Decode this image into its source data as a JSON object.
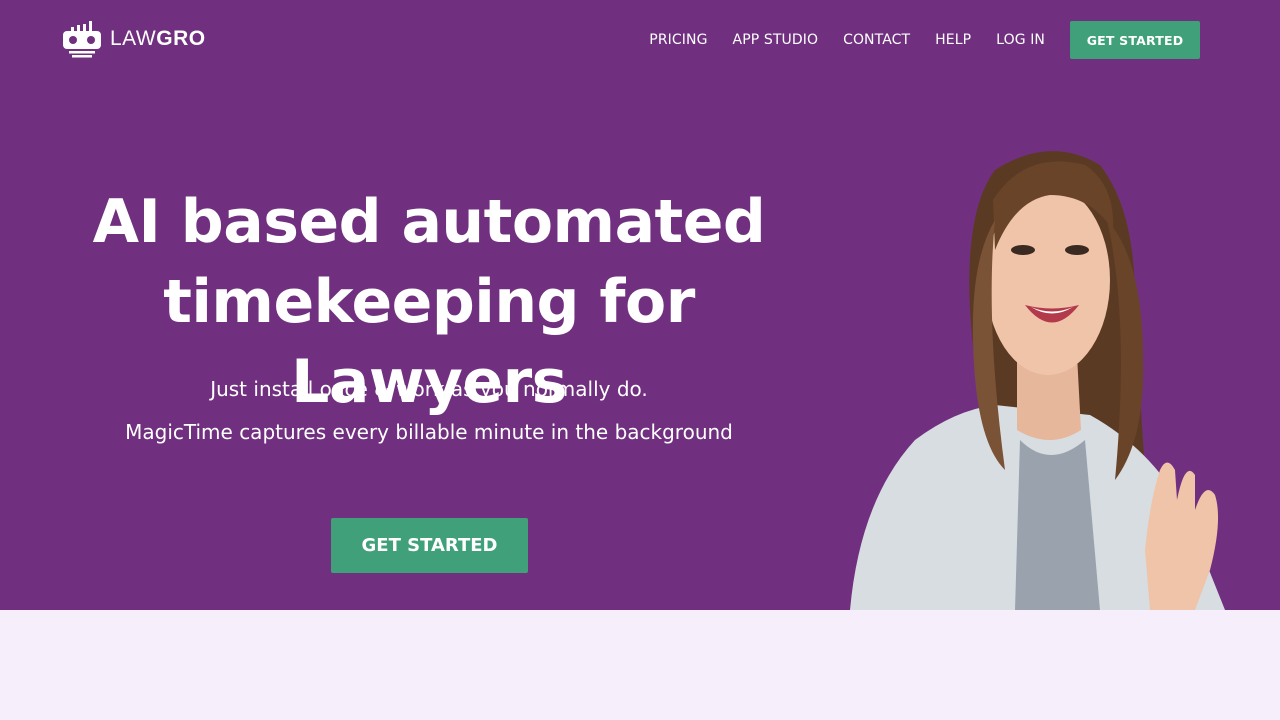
{
  "brand": {
    "name_light": "LAW",
    "name_bold": "GRO",
    "logo_icon": "robot-logo-icon"
  },
  "nav": {
    "items": [
      "PRICING",
      "APP STUDIO",
      "CONTACT",
      "HELP",
      "LOG IN"
    ],
    "cta_label": "GET STARTED"
  },
  "hero": {
    "title_line1": "AI based automated",
    "title_line2": "timekeeping for Lawyers",
    "subtitle_line1": "Just install once & work as you normally do.",
    "subtitle_line2": "MagicTime captures every billable minute in the background",
    "cta_label": "GET STARTED",
    "image": "smiling-woman-photo"
  },
  "colors": {
    "hero_bg": "#71307f",
    "accent": "#3fa079",
    "below_bg": "#f7eefb"
  }
}
